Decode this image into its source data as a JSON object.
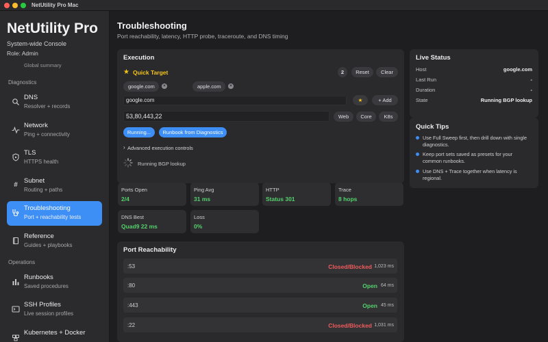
{
  "window": {
    "title": "NetUtility Pro Mac"
  },
  "sidebar": {
    "app_name": "NetUtility Pro",
    "subtitle": "System-wide Console",
    "role": "Role: Admin",
    "global_summary": "Global summary",
    "sections": {
      "diagnostics": "Diagnostics",
      "operations": "Operations"
    },
    "items": [
      {
        "title": "DNS",
        "sub": "Resolver + records",
        "icon": "search-icon"
      },
      {
        "title": "Network",
        "sub": "Ping + connectivity",
        "icon": "pulse-icon"
      },
      {
        "title": "TLS",
        "sub": "HTTPS health",
        "icon": "shield-icon"
      },
      {
        "title": "Subnet",
        "sub": "Routing + paths",
        "icon": "hash-icon"
      },
      {
        "title": "Troubleshooting",
        "sub": "Port + reachability tests",
        "icon": "stethoscope-icon",
        "active": true
      },
      {
        "title": "Reference",
        "sub": "Guides + playbooks",
        "icon": "book-icon"
      },
      {
        "title": "Runbooks",
        "sub": "Saved procedures",
        "icon": "bar-chart-icon"
      },
      {
        "title": "SSH Profiles",
        "sub": "Live session profiles",
        "icon": "terminal-icon"
      },
      {
        "title": "Kubernetes + Docker",
        "sub": "",
        "icon": "container-icon"
      }
    ]
  },
  "page": {
    "title": "Troubleshooting",
    "subtitle": "Port reachability, latency, HTTP probe, traceroute, and DNS timing"
  },
  "execution": {
    "title": "Execution",
    "quick_target_label": "Quick Target",
    "target_count": "2",
    "reset_label": "Reset",
    "clear_label": "Clear",
    "chips": [
      "google.com",
      "apple.com"
    ],
    "host_value": "google.com",
    "add_label": "Add",
    "ports_value": "53,80,443,22",
    "presets": [
      "Web",
      "Core",
      "K8s"
    ],
    "running_label": "Running...",
    "runbook_label": "Runbook from Diagnostics",
    "advanced_label": "Advanced execution controls",
    "status_text": "Running BGP lookup"
  },
  "stats": [
    {
      "label": "Ports Open",
      "value": "2/4"
    },
    {
      "label": "Ping Avg",
      "value": "31 ms"
    },
    {
      "label": "HTTP",
      "value": "Status 301"
    },
    {
      "label": "Trace",
      "value": "8 hops"
    },
    {
      "label": "DNS Best",
      "value": "Quad9 22 ms"
    },
    {
      "label": "Loss",
      "value": "0%"
    }
  ],
  "port_reachability": {
    "title": "Port Reachability",
    "rows": [
      {
        "port": ":53",
        "status": "Closed/Blocked",
        "ms": "1,023 ms",
        "open": false
      },
      {
        "port": ":80",
        "status": "Open",
        "ms": "64 ms",
        "open": true
      },
      {
        "port": ":443",
        "status": "Open",
        "ms": "45 ms",
        "open": true
      },
      {
        "port": ":22",
        "status": "Closed/Blocked",
        "ms": "1,031 ms",
        "open": false
      }
    ]
  },
  "live_status": {
    "title": "Live Status",
    "rows": [
      {
        "key": "Host",
        "value": "google.com"
      },
      {
        "key": "Last Run",
        "value": "-"
      },
      {
        "key": "Duration",
        "value": "-"
      },
      {
        "key": "State",
        "value": "Running BGP lookup"
      }
    ]
  },
  "quick_tips": {
    "title": "Quick Tips",
    "tips": [
      "Use Full Sweep first, then drill down with single diagnostics.",
      "Keep port sets saved as presets for your common runbooks.",
      "Use DNS + Trace together when latency is regional."
    ]
  },
  "colors": {
    "accent": "#3d8ef5",
    "open": "#53d26b",
    "closed": "#f05b5b",
    "star": "#f5c518"
  }
}
